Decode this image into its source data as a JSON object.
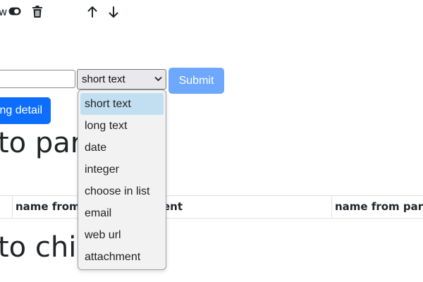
{
  "toolbar": {
    "label_fragment": "w",
    "toggle_icon": "toggle-icon",
    "delete_icon": "trash-icon",
    "up_icon": "arrow-up-icon",
    "down_icon": "arrow-down-icon"
  },
  "form": {
    "text_value": "",
    "type_select_value": "short text",
    "submit_label": "Submit"
  },
  "detail_button_label": "ng detail",
  "headings": {
    "parent": "to par",
    "child": "to chi"
  },
  "table": {
    "headers": [
      "name from",
      "ent",
      "name from pare"
    ]
  },
  "dropdown": {
    "options": [
      "short text",
      "long text",
      "date",
      "integer",
      "choose in list",
      "email",
      "web url",
      "attachment"
    ],
    "selected_index": 0
  },
  "colors": {
    "primary": "#0d6efd",
    "submit_disabled": "#6ea8fe",
    "option_highlight": "#c1dff0"
  }
}
